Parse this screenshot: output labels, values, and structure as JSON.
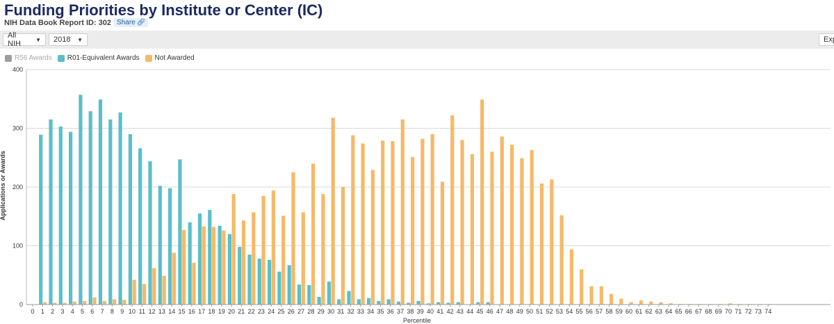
{
  "page": {
    "title": "Funding Priorities by Institute or Center (IC)",
    "report_id_label": "NIH Data Book Report ID: 302",
    "share_label": "Share"
  },
  "toolbar": {
    "ic_value": "All NIH",
    "year_value": "2018",
    "export_label": "Exp"
  },
  "legend": [
    {
      "name": "R56 Awards",
      "color": "#9e9e9e",
      "disabled": true
    },
    {
      "name": "R01-Equivalent Awards",
      "color": "#5bbfc9",
      "disabled": false
    },
    {
      "name": "Not Awarded",
      "color": "#f6b968",
      "disabled": false
    }
  ],
  "chart_data": {
    "type": "bar",
    "xlabel": "Percentile",
    "ylabel": "Applications or Awards",
    "ylim": [
      0,
      400
    ],
    "yticks": [
      0,
      100,
      200,
      300,
      400
    ],
    "grid": true,
    "categories": [
      "0",
      "1",
      "2",
      "3",
      "4",
      "5",
      "6",
      "7",
      "8",
      "9",
      "10",
      "11",
      "12",
      "13",
      "14",
      "15",
      "16",
      "17",
      "18",
      "19",
      "20",
      "21",
      "22",
      "23",
      "24",
      "25",
      "26",
      "27",
      "28",
      "29",
      "30",
      "31",
      "32",
      "33",
      "34",
      "35",
      "36",
      "37",
      "38",
      "39",
      "40",
      "41",
      "42",
      "43",
      "44",
      "45",
      "46",
      "47",
      "48",
      "49",
      "50",
      "51",
      "52",
      "53",
      "54",
      "55",
      "56",
      "57",
      "58",
      "59",
      "60",
      "61",
      "62",
      "63",
      "64",
      "65",
      "66",
      "67",
      "68",
      "69",
      "70",
      "71",
      "72",
      "73",
      "74"
    ],
    "series": [
      {
        "name": "R01-Equivalent Awards",
        "color": "#5bbfc9",
        "values": [
          0,
          289,
          315,
          303,
          294,
          357,
          329,
          349,
          315,
          327,
          290,
          266,
          244,
          202,
          198,
          247,
          140,
          155,
          161,
          134,
          120,
          98,
          85,
          78,
          76,
          56,
          67,
          34,
          33,
          13,
          39,
          9,
          23,
          9,
          11,
          6,
          9,
          5,
          3,
          6,
          2,
          4,
          3,
          4,
          0,
          4,
          4,
          0,
          0,
          0,
          0,
          0,
          0,
          0,
          0,
          0,
          0,
          0,
          0,
          0,
          0,
          0,
          0,
          0,
          0,
          0,
          0,
          0,
          0,
          0,
          0,
          0,
          0,
          0,
          0
        ]
      },
      {
        "name": "Not Awarded",
        "color": "#f6b968",
        "values": [
          0,
          4,
          3,
          3,
          5,
          6,
          12,
          6,
          9,
          8,
          42,
          35,
          62,
          49,
          88,
          127,
          71,
          133,
          132,
          126,
          188,
          143,
          157,
          185,
          194,
          151,
          225,
          157,
          240,
          188,
          318,
          200,
          288,
          274,
          229,
          279,
          278,
          315,
          251,
          282,
          290,
          209,
          322,
          280,
          256,
          349,
          260,
          286,
          272,
          249,
          263,
          206,
          213,
          152,
          94,
          60,
          31,
          31,
          18,
          10,
          4,
          7,
          5,
          4,
          2,
          1,
          1,
          1,
          1,
          1,
          2,
          1,
          1,
          1,
          1
        ]
      }
    ]
  }
}
